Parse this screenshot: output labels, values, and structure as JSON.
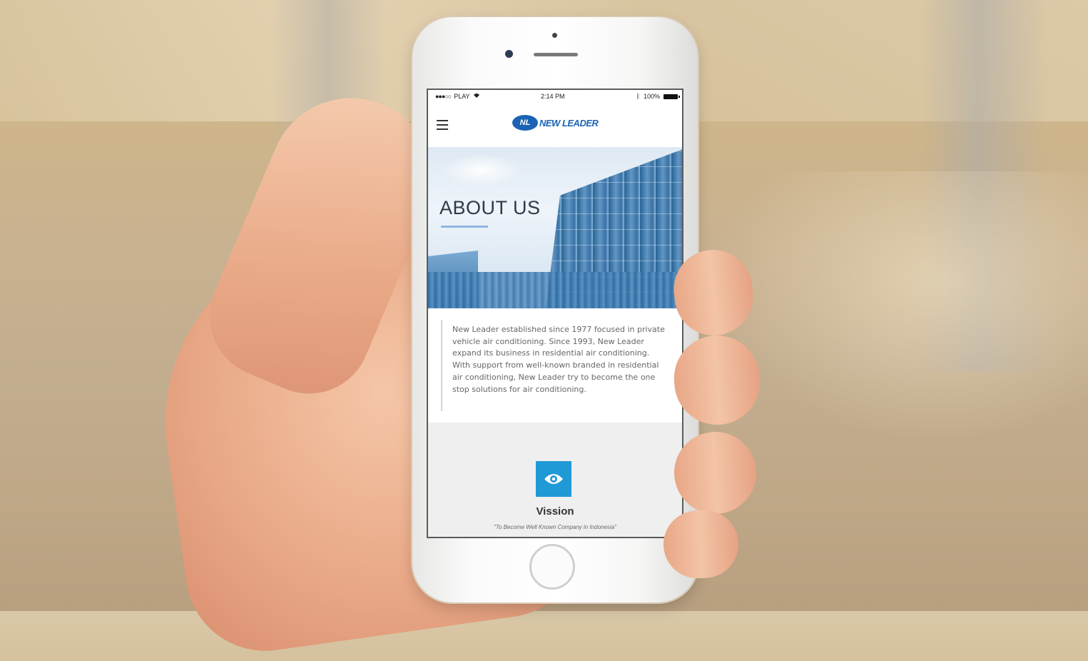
{
  "status_bar": {
    "carrier": "PLAY",
    "time": "2:14 PM",
    "battery": "100%"
  },
  "header": {
    "logo_badge": "NL",
    "logo_text": "NEW LEADER"
  },
  "hero": {
    "title": "ABOUT US"
  },
  "about": {
    "body": "New Leader established since 1977 focused in private vehicle air conditioning. Since 1993, New Leader expand its business in residential air conditioning. With support from well-known branded in residential air conditioning, New Leader try to become the one stop solutions for air conditioning."
  },
  "vision": {
    "title": "Vission",
    "quote": "\"To Become Well Known Company in Indonesia\""
  },
  "colors": {
    "brand_blue": "#1b64b4",
    "icon_blue": "#1f9ad6"
  },
  "icons": [
    "menu-icon",
    "wifi-icon",
    "bluetooth-icon",
    "battery-icon",
    "eye-icon"
  ]
}
